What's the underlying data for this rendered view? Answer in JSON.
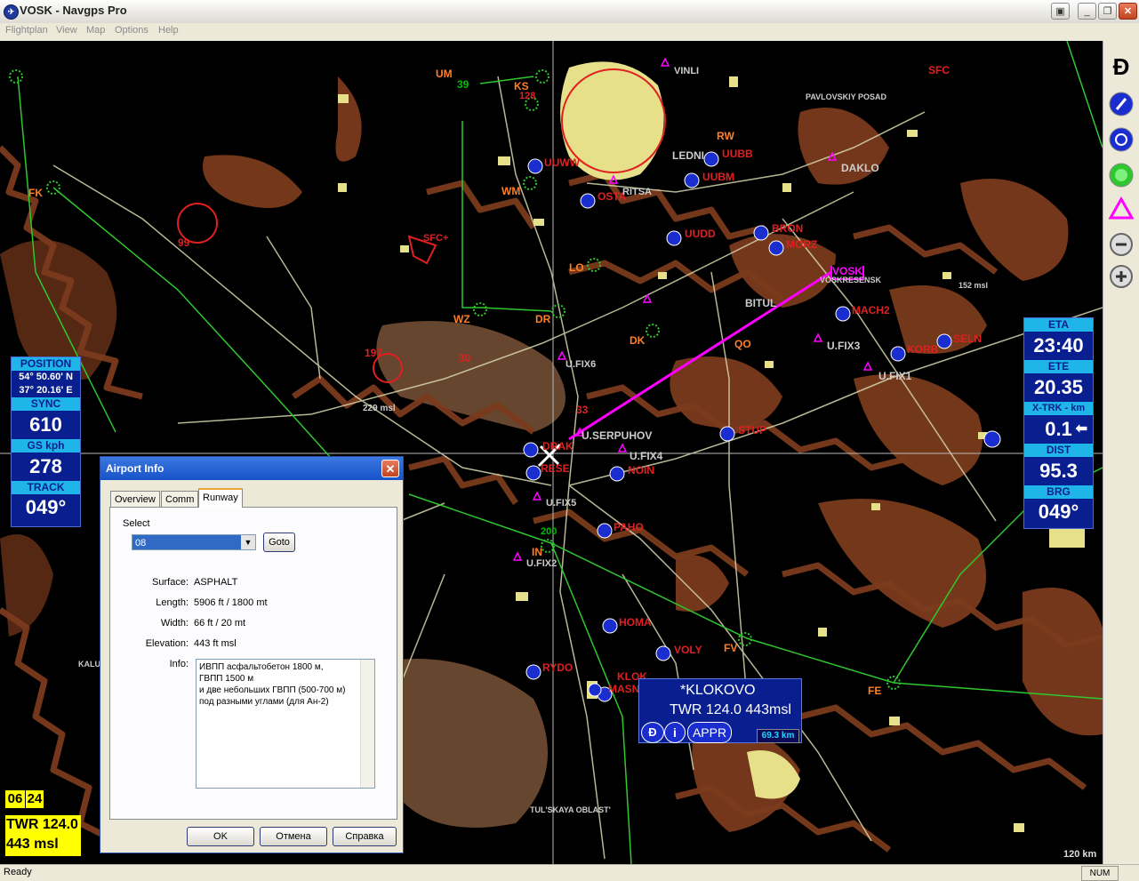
{
  "window": {
    "title": "VOSK - Navgps Pro"
  },
  "menu": [
    "Flightplan",
    "View",
    "Map",
    "Options",
    "Help"
  ],
  "status": {
    "text": "Ready",
    "num": "NUM"
  },
  "left_panel": {
    "position_label": "POSITION",
    "lat": "54° 50.60' N",
    "lon": "37° 20.16' E",
    "sync_label": "SYNC",
    "sync": "610",
    "gs_label": "GS kph",
    "gs": "278",
    "track_label": "TRACK",
    "track": "049°"
  },
  "right_panel": {
    "eta_label": "ETA",
    "eta": "23:40",
    "ete_label": "ETE",
    "ete": "20.35",
    "xtrk_label": "X-TRK - km",
    "xtrk": "0.1",
    "dist_label": "DIST",
    "dist": "95.3",
    "brg_label": "BRG",
    "brg": "049°"
  },
  "bottom_left": {
    "h1": "06",
    "h2": "24",
    "twr": "TWR 124.0",
    "msl": "443 msl"
  },
  "dialog": {
    "title": "Airport Info",
    "tabs": [
      "Overview",
      "Comm",
      "Runway"
    ],
    "select_label": "Select",
    "select_value": "08",
    "goto": "Goto",
    "surface_label": "Surface:",
    "surface": "ASPHALT",
    "length_label": "Length:",
    "length": "5906 ft / 1800 mt",
    "width_label": "Width:",
    "width": "66 ft / 20 mt",
    "elevation_label": "Elevation:",
    "elevation": "443 ft msl",
    "info_label": "Info:",
    "info_lines": [
      "ИВПП  асфальтобетон 1800 м,",
      "ГВПП 1500 м",
      "и две небольших ГВПП (500-700 м)",
      "под разными углами (для Ан-2)"
    ],
    "ok": "OK",
    "cancel": "Отмена",
    "help": "Справка"
  },
  "klokovo": {
    "name": "*KLOKOVO",
    "freq": "TWR 124.0  443msl",
    "appr": "APPR",
    "dist": "69.3 km"
  },
  "scale": "120 km",
  "map_labels": [
    {
      "t": "VOSK",
      "c": "#ff00ff"
    },
    {
      "t": "VOSKRESENSK",
      "c": "#cccccc"
    },
    {
      "t": "MACH2",
      "c": "#e02020"
    },
    {
      "t": "BITUL",
      "c": "#cccccc"
    },
    {
      "t": "U.FIX3",
      "c": "#cccccc"
    },
    {
      "t": "KORB",
      "c": "#e02020"
    },
    {
      "t": "SELN",
      "c": "#e02020"
    },
    {
      "t": "U.FIX1",
      "c": "#cccccc"
    },
    {
      "t": "U.FIX6",
      "c": "#cccccc"
    },
    {
      "t": "U.SERPUHOV",
      "c": "#cccccc"
    },
    {
      "t": "U.FIX4",
      "c": "#cccccc"
    },
    {
      "t": "NOIN",
      "c": "#e02020"
    },
    {
      "t": "STUP",
      "c": "#e02020"
    },
    {
      "t": "DRAK",
      "c": "#e02020"
    },
    {
      "t": "RESE",
      "c": "#e02020"
    },
    {
      "t": "U.FIX5",
      "c": "#cccccc"
    },
    {
      "t": "PAHO",
      "c": "#e02020"
    },
    {
      "t": "U.FIX2",
      "c": "#cccccc"
    },
    {
      "t": "HOMA",
      "c": "#e02020"
    },
    {
      "t": "VOLY",
      "c": "#e02020"
    },
    {
      "t": "RYDO",
      "c": "#e02020"
    },
    {
      "t": "KLOK",
      "c": "#e02020"
    },
    {
      "t": "MASN",
      "c": "#e02020"
    },
    {
      "t": "LEDNI",
      "c": "#cccccc"
    },
    {
      "t": "UUBB",
      "c": "#e02020"
    },
    {
      "t": "UUBM",
      "c": "#e02020"
    },
    {
      "t": "UUWW",
      "c": "#e02020"
    },
    {
      "t": "OSTA",
      "c": "#e02020"
    },
    {
      "t": "UUDD",
      "c": "#e02020"
    },
    {
      "t": "BRON",
      "c": "#e02020"
    },
    {
      "t": "MORZ",
      "c": "#e02020"
    },
    {
      "t": "DAKLO",
      "c": "#cccccc"
    },
    {
      "t": "VINLI",
      "c": "#cccccc"
    },
    {
      "t": "RW",
      "c": "#ff7f27"
    },
    {
      "t": "FK",
      "c": "#ff7f27"
    },
    {
      "t": "UM",
      "c": "#ff7f27"
    },
    {
      "t": "KS",
      "c": "#ff7f27"
    },
    {
      "t": "WM",
      "c": "#ff7f27"
    },
    {
      "t": "WZ",
      "c": "#ff7f27"
    },
    {
      "t": "DR",
      "c": "#ff7f27"
    },
    {
      "t": "LO",
      "c": "#ff7f27"
    },
    {
      "t": "DK",
      "c": "#ff7f27"
    },
    {
      "t": "QO",
      "c": "#ff7f27"
    },
    {
      "t": "FV",
      "c": "#ff7f27"
    },
    {
      "t": "FE",
      "c": "#ff7f27"
    },
    {
      "t": "IN",
      "c": "#ff7f27"
    },
    {
      "t": "SFC",
      "c": "#e02020"
    },
    {
      "t": "229 msl",
      "c": "#cccccc"
    },
    {
      "t": "152 msl",
      "c": "#cccccc"
    },
    {
      "t": "KALUZ",
      "c": "#cccccc"
    },
    {
      "t": "TUL'SKAYA OBLAST'",
      "c": "#cccccc"
    },
    {
      "t": "RITSA",
      "c": "#cccccc"
    },
    {
      "t": "PAVLOVSKIY POSAD",
      "c": "#cccccc"
    },
    {
      "t": "39",
      "c": "#00c000"
    },
    {
      "t": "200",
      "c": "#00c000"
    },
    {
      "t": "197",
      "c": "#e02020"
    },
    {
      "t": "99",
      "c": "#e02020"
    },
    {
      "t": "30",
      "c": "#e02020"
    },
    {
      "t": "33",
      "c": "#e02020"
    },
    {
      "t": "128",
      "c": "#e02020"
    },
    {
      "t": "SFC+",
      "c": "#e02020"
    }
  ]
}
